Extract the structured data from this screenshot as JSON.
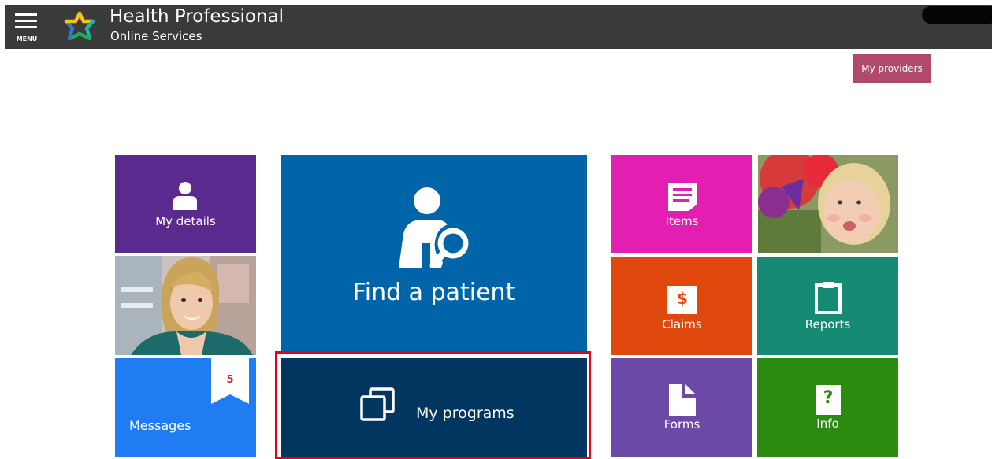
{
  "header": {
    "menu_label": "MENU",
    "title": "Health Professional",
    "subtitle": "Online Services",
    "logo_icon": "star-logo-icon",
    "menu_icon": "hamburger-icon"
  },
  "top_actions": {
    "my_providers_label": "My providers"
  },
  "tiles": {
    "my_details": {
      "label": "My details",
      "icon": "person-icon",
      "color": "#5b2a8f"
    },
    "find_patient": {
      "label": "Find a patient",
      "icon": "person-search-icon",
      "color": "#0064a8"
    },
    "my_programs": {
      "label": "My programs",
      "icon": "copy-squares-icon",
      "color": "#003660"
    },
    "messages": {
      "label": "Messages",
      "badge": "5",
      "icon": "bookmark-badge-icon",
      "color": "#1f7cf2"
    },
    "items": {
      "label": "Items",
      "icon": "document-list-icon",
      "color": "#e21fb0"
    },
    "claims": {
      "label": "Claims",
      "icon": "dollar-icon",
      "color": "#e0480e"
    },
    "reports": {
      "label": "Reports",
      "icon": "clipboard-icon",
      "color": "#168a73"
    },
    "forms": {
      "label": "Forms",
      "icon": "form-document-icon",
      "color": "#6e4aa8"
    },
    "info": {
      "label": "Info",
      "icon": "question-icon",
      "color": "#2b8a10"
    }
  },
  "photos": {
    "nurse": "nurse-photo",
    "child": "child-photo"
  },
  "colors": {
    "topbar": "#3a3a3a",
    "my_providers": "#b04a6a",
    "highlight": "#e3001b"
  }
}
